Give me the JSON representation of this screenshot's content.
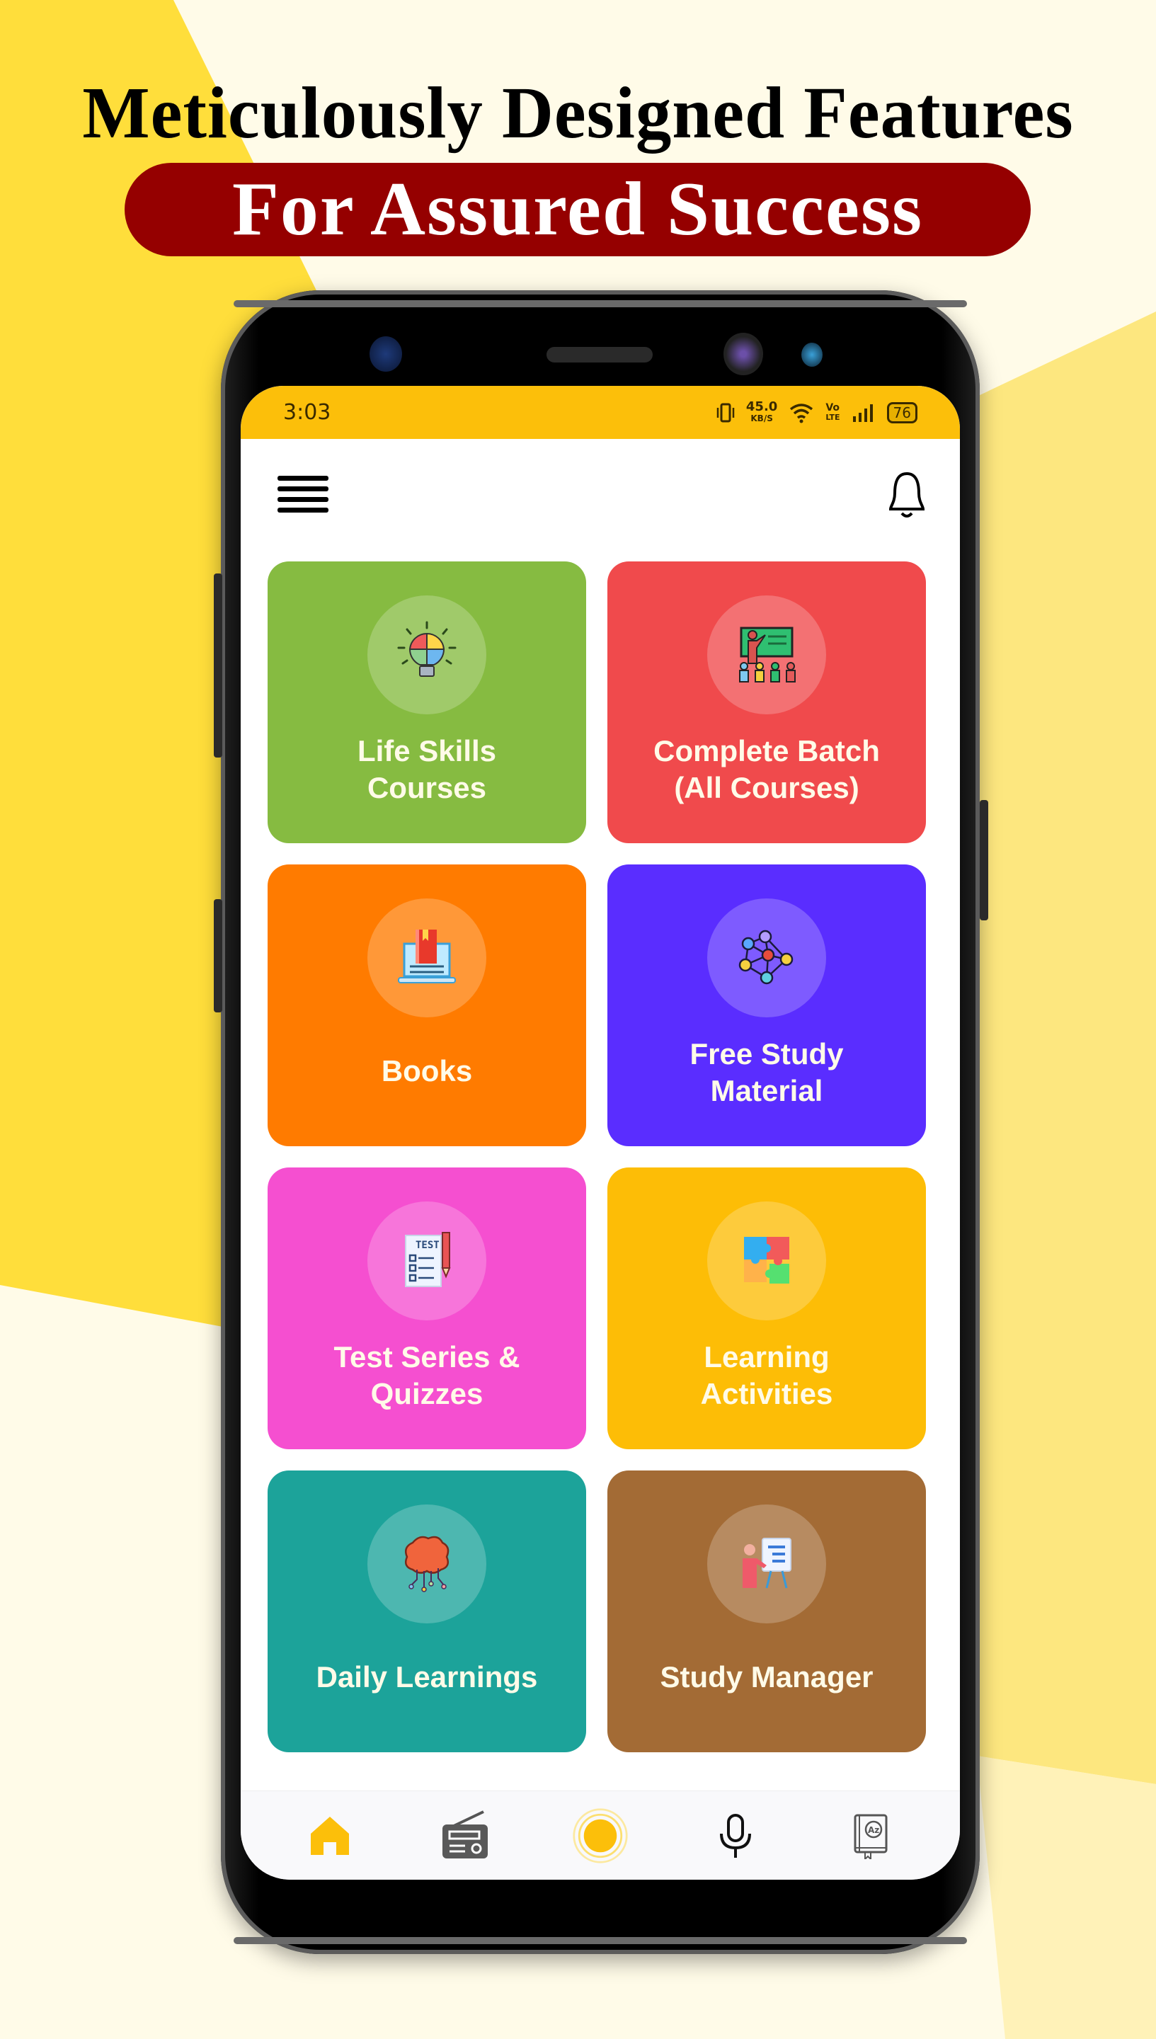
{
  "promo": {
    "headline": "Meticulously Designed Features",
    "tagline": "For Assured Success",
    "colors": {
      "tagline_bg": "#950000",
      "bg_yellow": "#ffde3b",
      "bg_cream": "#fffbe8"
    }
  },
  "status_bar": {
    "time": "3:03",
    "net_speed_value": "45.0",
    "net_speed_unit": "KB/S",
    "volte_top": "Vo",
    "volte_bottom": "LTE",
    "battery": "76",
    "icons": [
      "vibrate-icon",
      "wifi-icon",
      "volte-icon",
      "signal-icon",
      "battery-icon"
    ],
    "bg_color": "#fcbf0a"
  },
  "top_bar": {
    "menu_icon": "hamburger-menu-icon",
    "notification_icon": "bell-icon"
  },
  "tiles": [
    {
      "label": "Life Skills\nCourses",
      "icon": "lightbulb-puzzle-icon",
      "color": "#86bb41"
    },
    {
      "label": "Complete Batch\n(All Courses)",
      "icon": "teacher-classroom-icon",
      "color": "#f04a4c"
    },
    {
      "label": "Books",
      "icon": "laptop-book-icon",
      "color": "#ff7b00"
    },
    {
      "label": "Free Study\nMaterial",
      "icon": "network-nodes-icon",
      "color": "#5a2dff"
    },
    {
      "label": "Test Series &\nQuizzes",
      "icon": "test-sheet-pencil-icon",
      "color": "#f54fd0"
    },
    {
      "label": "Learning\nActivities",
      "icon": "puzzle-pieces-icon",
      "color": "#fdbd06"
    },
    {
      "label": "Daily Learnings",
      "icon": "brain-circuit-icon",
      "color": "#1ca39a"
    },
    {
      "label": "Study Manager",
      "icon": "presenter-board-icon",
      "color": "#a36b35"
    }
  ],
  "bottom_nav": [
    {
      "name": "home",
      "icon": "home-icon",
      "active": true
    },
    {
      "name": "radio",
      "icon": "radio-icon",
      "active": false
    },
    {
      "name": "live",
      "icon": "live-dot-icon",
      "active": false
    },
    {
      "name": "voice",
      "icon": "microphone-icon",
      "active": false
    },
    {
      "name": "dictionary",
      "icon": "dictionary-book-icon",
      "active": false
    }
  ],
  "accent_color": "#fcbf0a"
}
